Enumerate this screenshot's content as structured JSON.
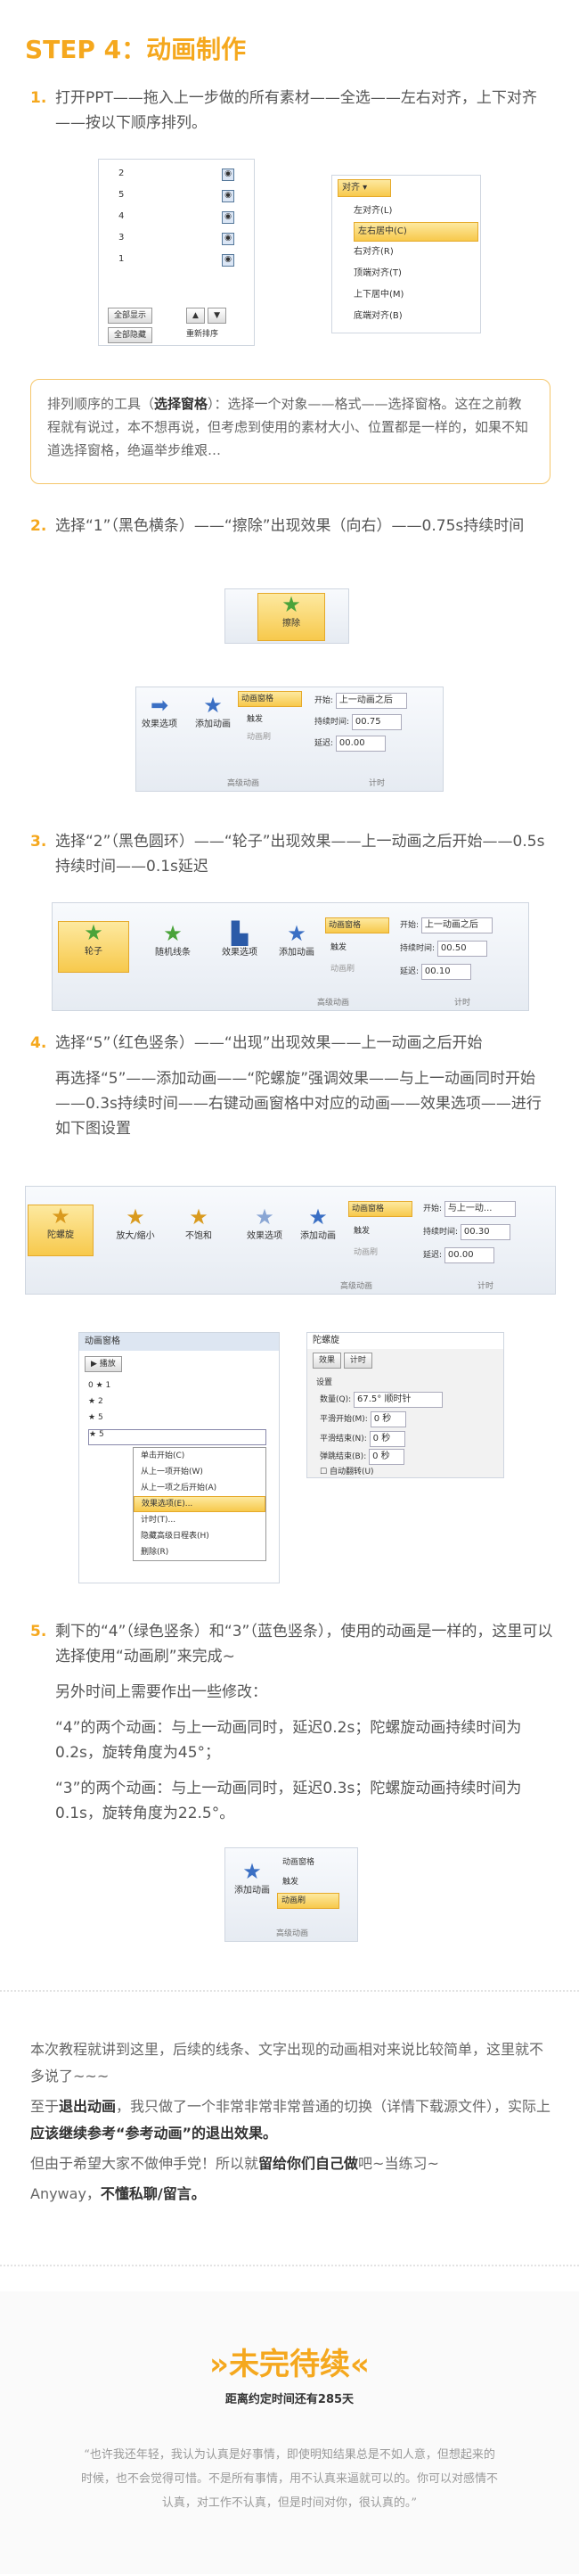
{
  "title": "STEP 4：动画制作",
  "steps": [
    {
      "num": "1.",
      "text": "打开PPT——拖入上一步做的所有素材——全选——左右对齐，上下对齐——按以下顺序排列。"
    },
    {
      "num": "2.",
      "text": "选择“1”（黑色横条）——“擦除”出现效果（向右）——0.75s持续时间"
    },
    {
      "num": "3.",
      "text": "选择“2”（黑色圆环）——“轮子”出现效果——上一动画之后开始——0.5s持续时间——0.1s延迟"
    },
    {
      "num": "4.",
      "text": "选择“5”（红色竖条）——“出现”出现效果——上一动画之后开始",
      "extra": "再选择“5”——添加动画——“陀螺旋”强调效果——与上一动画同时开始——0.3s持续时间——右键动画窗格中对应的动画——效果选项——进行如下图设置"
    },
    {
      "num": "5.",
      "text": "剩下的“4”（绿色竖条）和“3”（蓝色竖条），使用的动画是一样的，这里可以选择使用“动画刷”来完成~",
      "p1": "另外时间上需要作出一些修改：",
      "p2": "“4”的两个动画：与上一动画同时，延迟0.2s；陀螺旋动画持续时间为0.2s，旋转角度为45°；",
      "p3": "“3”的两个动画：与上一动画同时，延迟0.3s；陀螺旋动画持续时间为0.1s，旋转角度为22.5°。"
    }
  ],
  "note": {
    "a": "排列顺序的工具（",
    "k": "选择窗格",
    "b": "）：选择一个对象——格式——选择窗格。这在之前教程就有说过，本不想再说，但考虑到使用的素材大小、位置都是一样的，如果不知道选择窗格，绝逼举步维艰…"
  },
  "shot1": {
    "order": [
      "2",
      "5",
      "4",
      "3",
      "1"
    ],
    "show_all": "全部显示",
    "hide_all": "全部隐藏",
    "reorder": "重新排序",
    "align_btn": "对齐",
    "align_items": [
      "左对齐(L)",
      "左右居中(C)",
      "右对齐(R)",
      "顶端对齐(T)",
      "上下居中(M)",
      "底端对齐(B)"
    ]
  },
  "ui": {
    "wipe": "擦除",
    "effect_options": "效果选项",
    "add_animation": "添加动画",
    "animation_pane": "动画窗格",
    "trigger": "触发",
    "painter": "动画刷",
    "start": "开始:",
    "duration": "持续时间:",
    "delay": "延迟:",
    "adv_group": "高级动画",
    "timing_group": "计时",
    "wheel": "轮子",
    "random_bars": "随机线条",
    "spin": "陀螺旋",
    "grow_shrink": "放大/缩小",
    "desaturate": "不饱和"
  },
  "s2": {
    "start_val": "上一动画之后",
    "duration_val": "00.75",
    "delay_val": "00.00"
  },
  "s3": {
    "start_val": "上一动画之后",
    "duration_val": "00.50",
    "delay_val": "00.10"
  },
  "s4": {
    "start_val": "与上一动...",
    "duration_val": "00.30",
    "delay_val": "00.00"
  },
  "pane": {
    "title": "动画窗格",
    "play": "播放",
    "items": [
      "1",
      "2",
      "5",
      "5"
    ],
    "menu": [
      "单击开始(C)",
      "从上一项开始(W)",
      "从上一项之后开始(A)",
      "效果选项(E)...",
      "计时(T)...",
      "隐藏高级日程表(H)",
      "删除(R)"
    ],
    "dialog_title": "陀螺旋",
    "tab1": "效果",
    "tab2": "计时",
    "settings": "设置",
    "amount": "数量(Q):",
    "amount_val": "67.5° 顺时针",
    "smooth_start": "平滑开始(M):",
    "smooth_end": "平滑结束(N):",
    "bounce_end": "弹跳结束(B):",
    "auto_reverse": "自动翻转(U)",
    "zero_s": "0 秒"
  },
  "footer": {
    "l1": "本次教程就讲到这里，后续的线条、文字出现的动画相对来说比较简单，这里就不多说了~~~",
    "l2a": "至于",
    "l2k": "退出动画",
    "l2b": "，我只做了一个非常非常非常普通的切换（详情下载源文件），实际上",
    "l2k2": "应该继续参考“参考动画”的退出效果。",
    "l3a": "但由于希望大家不做伸手党！所以就",
    "l3k": "留给你们自己做",
    "l3b": "吧~当练习~",
    "l4a": "Anyway，",
    "l4k": "不懂私聊/留言。"
  },
  "end": {
    "title": "»未完待续«",
    "subtitle": "距离约定时间还有285天",
    "quote": "“也许我还年轻，我认为认真是好事情，即使明知结果总是不如人意，但想起来的时候，也不会觉得可惜。不是所有事情，用不认真来逼就可以的。你可以对感情不认真，对工作不认真，但是时间对你，很认真的。”"
  }
}
